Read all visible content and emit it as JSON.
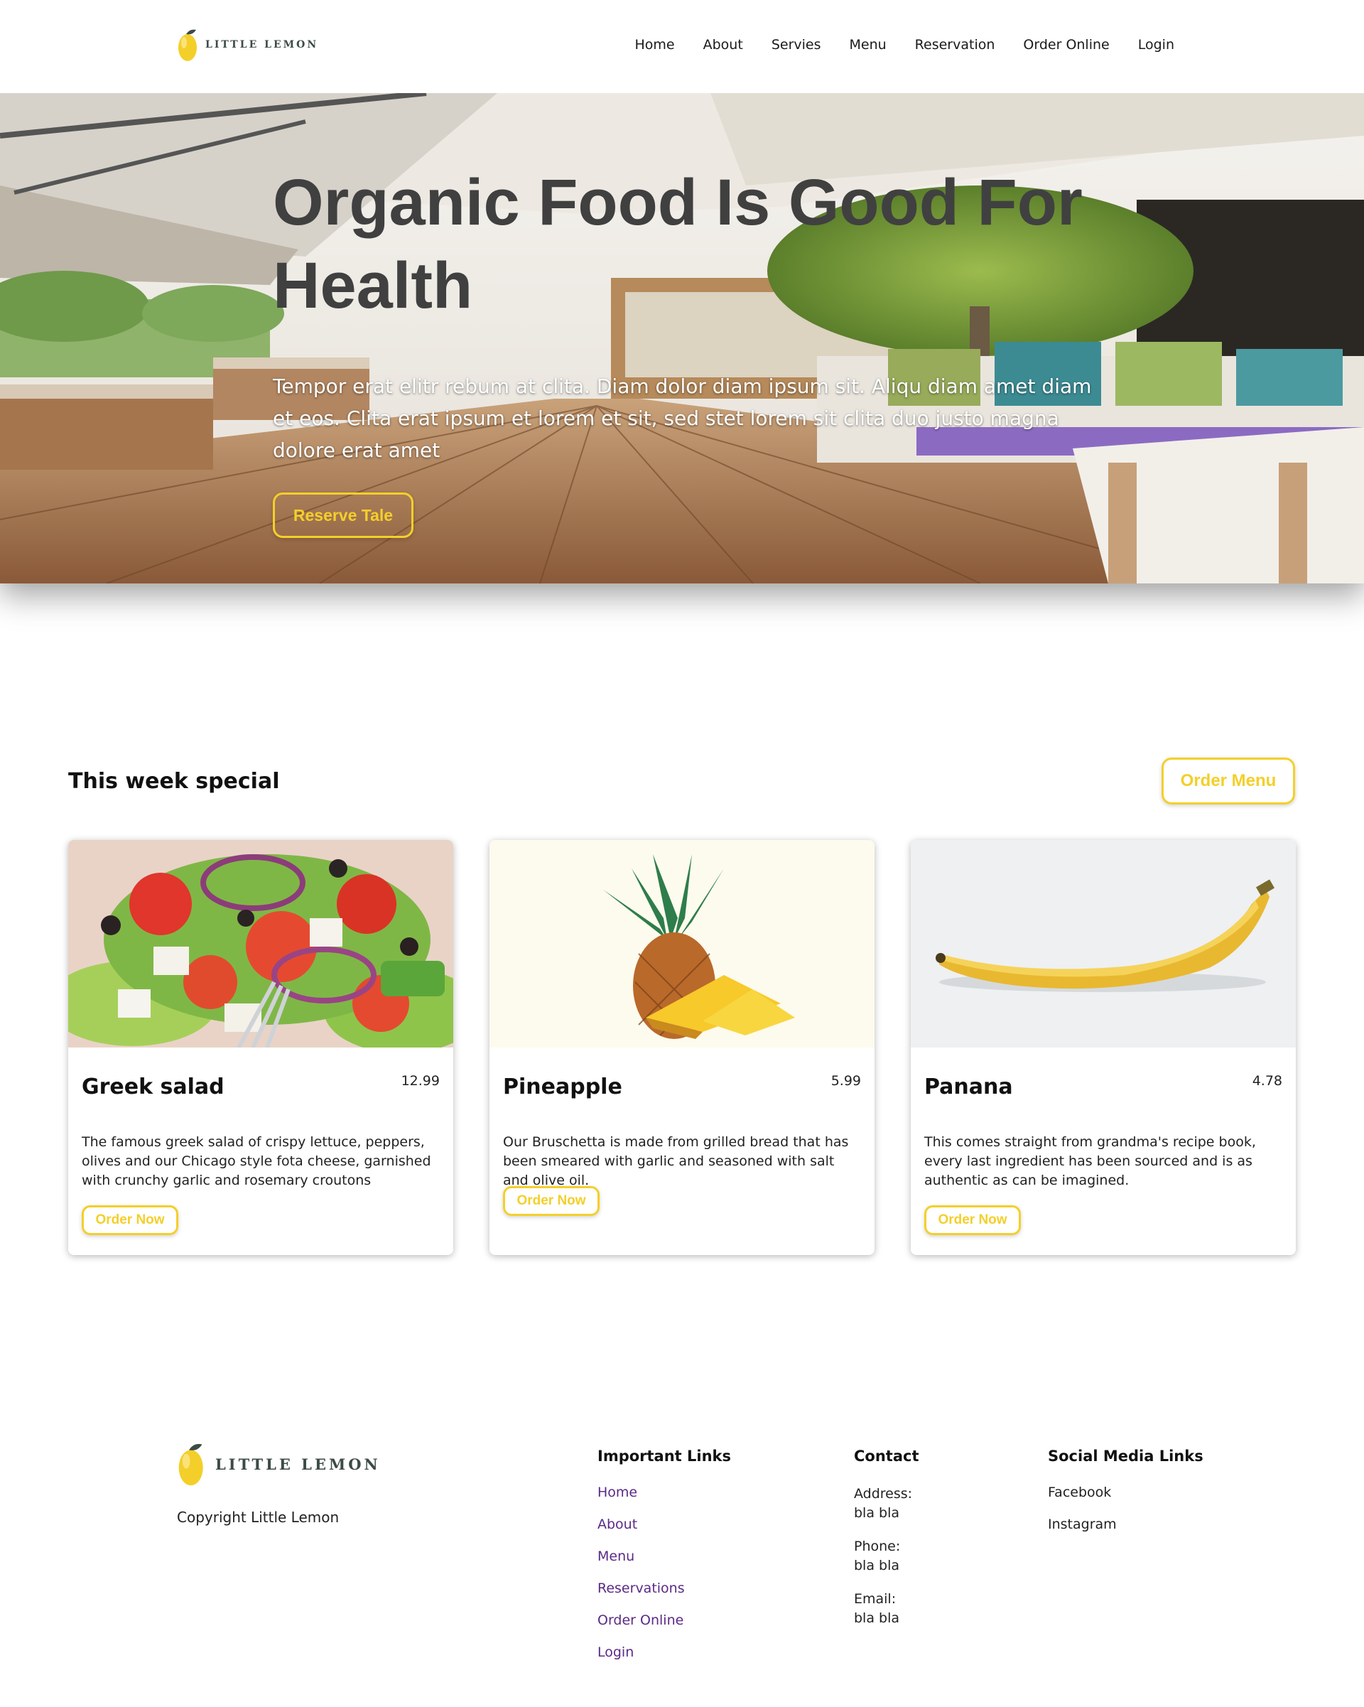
{
  "nav": {
    "brand": "LITTLE LEMON",
    "links": [
      "Home",
      "About",
      "Servies",
      "Menu",
      "Reservation",
      "Order Online",
      "Login"
    ]
  },
  "hero": {
    "title": "Organic Food Is Good For Health",
    "text": "Tempor erat elitr rebum at clita. Diam dolor diam ipsum sit. Aliqu diam amet diam et eos. Clita erat ipsum et lorem et sit, sed stet lorem sit clita duo justo magna dolore erat amet",
    "button": "Reserve Tale"
  },
  "specials": {
    "title": "This week special",
    "order_menu": "Order Menu",
    "cards": [
      {
        "name": "Greek salad",
        "price": "12.99",
        "description": "The famous greek salad of crispy lettuce, peppers, olives and our Chicago style fota cheese, garnished with crunchy garlic and rosemary croutons",
        "button": "Order Now"
      },
      {
        "name": "Pineapple",
        "price": "5.99",
        "description": "Our Bruschetta is made from grilled bread that has been smeared with garlic and seasoned with salt and olive oil.",
        "button": "Order Now"
      },
      {
        "name": "Panana",
        "price": "4.78",
        "description": "This comes straight from grandma's recipe book, every last ingredient has been sourced and is as authentic as can be imagined.",
        "button": "Order Now"
      }
    ]
  },
  "footer": {
    "brand": "LITTLE LEMON",
    "copyright": "Copyright Little Lemon",
    "important": {
      "title": "Important Links",
      "links": [
        "Home",
        "About",
        "Menu",
        "Reservations",
        "Order Online",
        "Login"
      ]
    },
    "contact": {
      "title": "Contact",
      "address_label": "Address:",
      "address_value": "bla bla",
      "phone_label": "Phone:",
      "phone_value": "bla bla",
      "email_label": "Email:",
      "email_value": "bla bla"
    },
    "social": {
      "title": "Social Media Links",
      "links": [
        "Facebook",
        "Instagram"
      ]
    }
  },
  "colors": {
    "accent": "#f4cf2a",
    "footer_link": "#5b2a86",
    "logo_green": "#3c4b45"
  }
}
